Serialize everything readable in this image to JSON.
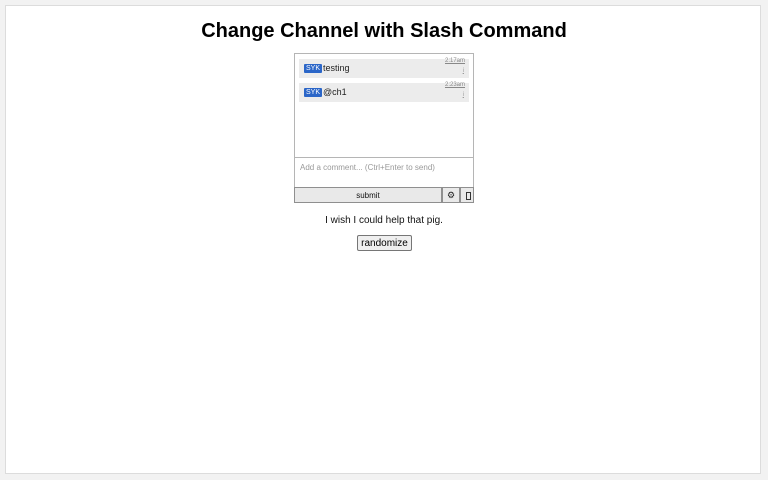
{
  "page": {
    "title": "Change Channel with Slash Command"
  },
  "chat": {
    "messages": [
      {
        "tag": "SYK",
        "text": "testing",
        "time": "2:17am",
        "mini": "i"
      },
      {
        "tag": "SYK",
        "text": "@ch1",
        "time": "2:23am",
        "mini": "i"
      }
    ],
    "input": {
      "placeholder": "Add a comment... (Ctrl+Enter to send)",
      "value": ""
    },
    "submit_label": "submit",
    "gear_glyph": "⚙",
    "gear_icon": "gear-icon",
    "emoji_icon": "emoji-icon"
  },
  "prompt": {
    "text": "I wish I could help that pig."
  },
  "randomize_label": "randomize",
  "colors": {
    "tag_background": "#2b66c8",
    "message_background": "#ececec"
  }
}
